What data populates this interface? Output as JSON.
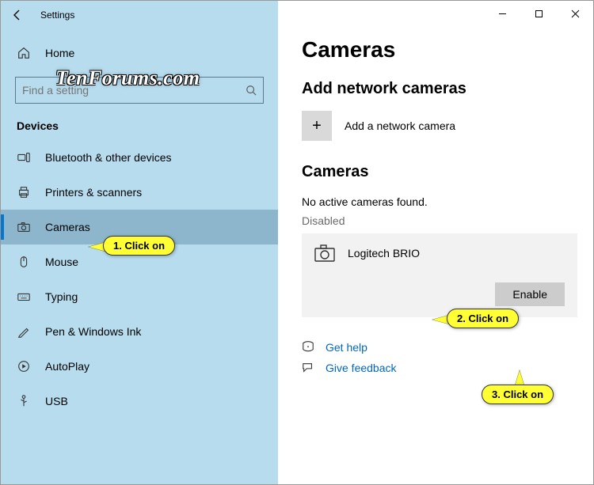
{
  "app_title": "Settings",
  "watermark": "TenForums.com",
  "home_label": "Home",
  "search_placeholder": "Find a setting",
  "section_label": "Devices",
  "sidebar": {
    "items": [
      {
        "label": "Bluetooth & other devices"
      },
      {
        "label": "Printers & scanners"
      },
      {
        "label": "Cameras"
      },
      {
        "label": "Mouse"
      },
      {
        "label": "Typing"
      },
      {
        "label": "Pen & Windows Ink"
      },
      {
        "label": "AutoPlay"
      },
      {
        "label": "USB"
      }
    ]
  },
  "page_title": "Cameras",
  "add_section_title": "Add network cameras",
  "add_row_label": "Add a network camera",
  "cameras_section_title": "Cameras",
  "no_active_text": "No active cameras found.",
  "disabled_label": "Disabled",
  "camera_name": "Logitech BRIO",
  "enable_btn": "Enable",
  "help_link": "Get help",
  "feedback_link": "Give feedback",
  "callouts": {
    "c1": "1. Click on",
    "c2": "2. Click on",
    "c3": "3. Click on"
  }
}
